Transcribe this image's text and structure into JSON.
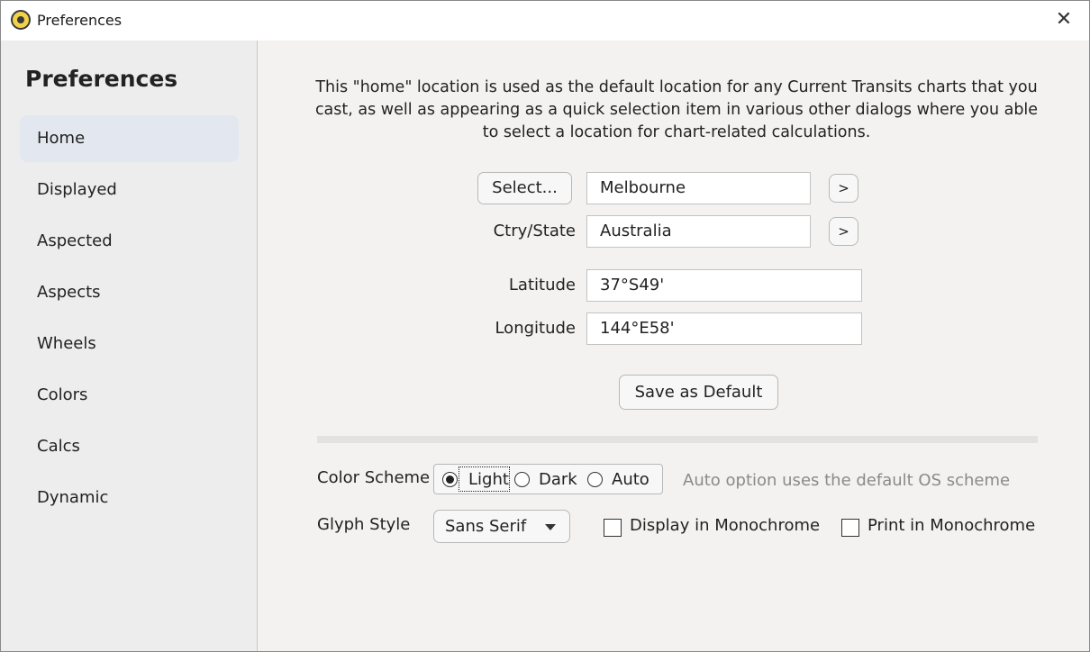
{
  "window": {
    "title": "Preferences",
    "close_glyph": "✕"
  },
  "sidebar": {
    "title": "Preferences",
    "items": [
      {
        "label": "Home",
        "active": true
      },
      {
        "label": "Displayed"
      },
      {
        "label": "Aspected"
      },
      {
        "label": "Aspects"
      },
      {
        "label": "Wheels"
      },
      {
        "label": "Colors"
      },
      {
        "label": "Calcs"
      },
      {
        "label": "Dynamic"
      }
    ]
  },
  "home": {
    "intro": "This \"home\" location is used as the default location for any Current Transits charts that you cast, as well as appearing as a quick selection item in various other dialogs where you able to select a location for chart-related calculations.",
    "select_button": "Select...",
    "city_value": "Melbourne",
    "city_expand": ">",
    "country_label": "Ctry/State",
    "country_value": "Australia",
    "country_expand": ">",
    "latitude_label": "Latitude",
    "latitude_value": "37°S49'",
    "longitude_label": "Longitude",
    "longitude_value": "144°E58'",
    "save_default_button": "Save as Default"
  },
  "appearance": {
    "color_scheme_label": "Color Scheme",
    "color_scheme_options": [
      "Light",
      "Dark",
      "Auto"
    ],
    "color_scheme_selected": "Light",
    "color_scheme_hint": "Auto option uses the default OS scheme",
    "glyph_style_label": "Glyph Style",
    "glyph_style_value": "Sans Serif",
    "display_mono_label": "Display in Monochrome",
    "display_mono_checked": false,
    "print_mono_label": "Print in Monochrome",
    "print_mono_checked": false
  },
  "icons": {
    "app": "app-logo-icon",
    "close": "close-icon",
    "dropdown": "chevron-down-icon"
  },
  "colors": {
    "active_nav_bg": "#e3e8f0",
    "hint_text": "#8a8a8a"
  }
}
